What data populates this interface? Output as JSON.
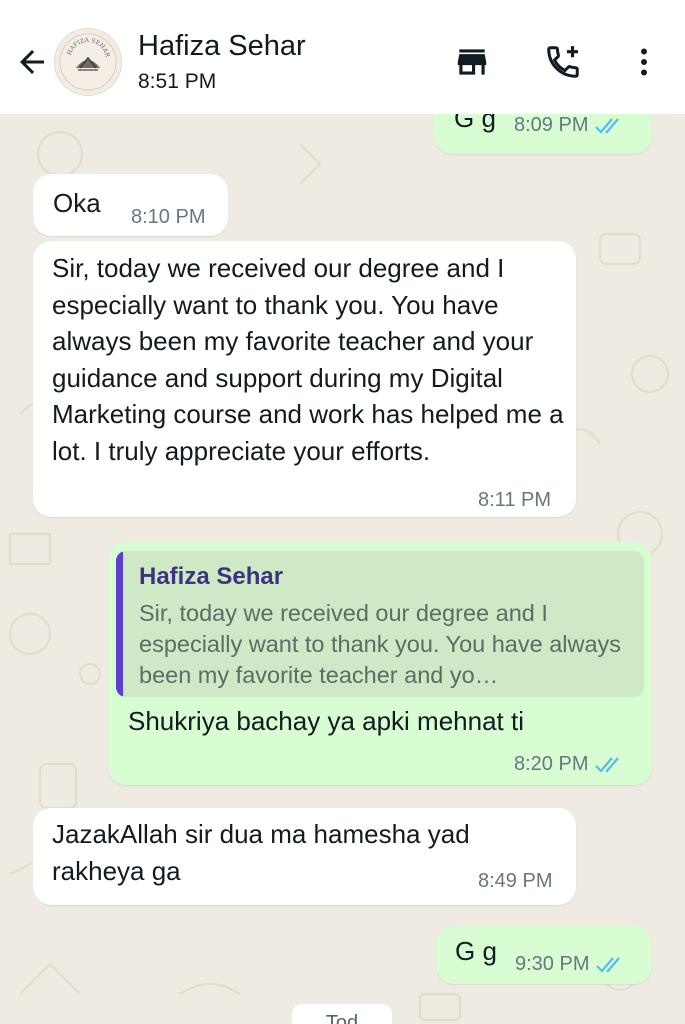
{
  "header": {
    "contact_name": "Hafiza Sehar",
    "status": "8:51 PM",
    "avatar_logo_text": "HAFIZA SEHAR",
    "icons": [
      "back-arrow-icon",
      "store-icon",
      "add-call-icon",
      "more-vert-icon"
    ]
  },
  "messages": [
    {
      "direction": "out",
      "text": "G g",
      "time": "8:09 PM",
      "ticks": "read"
    },
    {
      "direction": "in",
      "text": "Oka",
      "time": "8:10 PM"
    },
    {
      "direction": "in",
      "text": "Sir, today we received our degree and I especially want to thank you. You have always been my favorite teacher and your guidance and support during my Digital Marketing course and work has helped me a lot. I truly appreciate your efforts.",
      "time": "8:11 PM"
    },
    {
      "direction": "out",
      "reply_to": {
        "author": "Hafiza Sehar",
        "text": "Sir, today we received our degree and I especially want to thank you. You have always been my favorite teacher and yo…"
      },
      "text": "Shukriya bachay ya apki mehnat ti",
      "time": "8:20 PM",
      "ticks": "read"
    },
    {
      "direction": "in",
      "text": "JazakAllah sir dua ma hamesha yad rakheya ga",
      "time": "8:49 PM"
    },
    {
      "direction": "out",
      "text": "G g",
      "time": "9:30 PM",
      "ticks": "read"
    }
  ],
  "colors": {
    "incoming_bubble": "#ffffff",
    "outgoing_bubble": "#d9fdd3",
    "read_ticks": "#53bdeb",
    "quote_bar": "#5b3fd6",
    "chat_background": "#efeae2"
  },
  "date_pill_partial": "Tod"
}
